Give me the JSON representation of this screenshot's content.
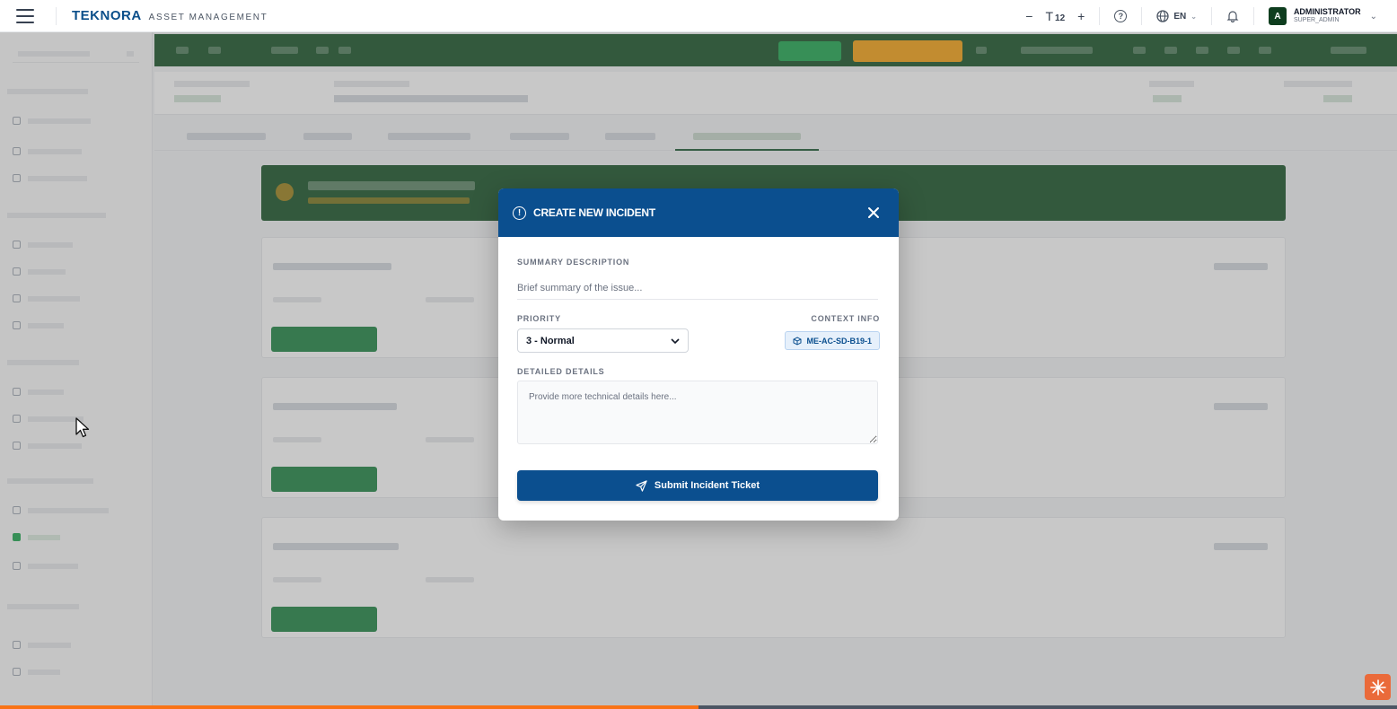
{
  "app": {
    "brand_logo": "TEKNORA",
    "brand_subtitle": "ASSET MANAGEMENT"
  },
  "topbar": {
    "font_decrease": "−",
    "font_icon": "T",
    "font_size": "12",
    "font_increase": "+",
    "help_icon": "?",
    "language": "EN",
    "avatar_initial": "A",
    "user_name": "ADMINISTRATOR",
    "user_role": "SUPER_ADMIN"
  },
  "modal": {
    "title": "CREATE NEW INCIDENT",
    "summary_label": "SUMMARY DESCRIPTION",
    "summary_placeholder": "Brief summary of the issue...",
    "summary_value": "",
    "priority_label": "PRIORITY",
    "priority_value": "3 - Normal",
    "context_label": "CONTEXT INFO",
    "context_value": "ME-AC-SD-B19-1",
    "details_label": "DETAILED DETAILS",
    "details_placeholder": "Provide more technical details here...",
    "submit_label": "Submit Incident Ticket"
  },
  "progress": {
    "fraction": 0.5
  },
  "colors": {
    "modal_header": "#0b4f8f",
    "toolbar_green": "#0f4d1f",
    "accent_orange": "#f59e0b",
    "progress_orange": "#f97316"
  }
}
